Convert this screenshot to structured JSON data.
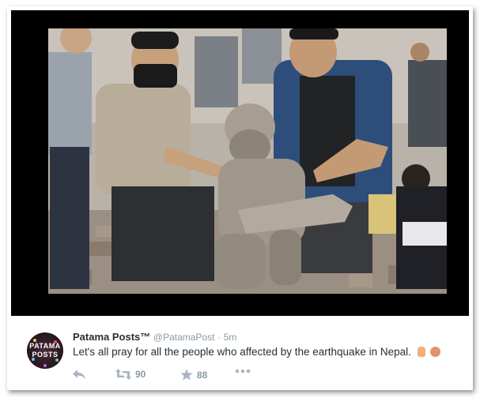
{
  "tweet": {
    "display_name": "Patama Posts™",
    "handle": "@PatamaPost",
    "separator": "·",
    "time": "5m",
    "text": "Let's all pray for all the people who affected by the earthquake in Nepal.",
    "avatar_text": [
      "PATAMA",
      "POSTS"
    ],
    "retweet_count": "90",
    "favorite_count": "88"
  },
  "icons": [
    "reply-icon",
    "retweet-icon",
    "favorite-icon",
    "more-icon"
  ],
  "colors": {
    "name": "#292f33",
    "meta": "#8899a6",
    "photo_frame": "#000000"
  }
}
